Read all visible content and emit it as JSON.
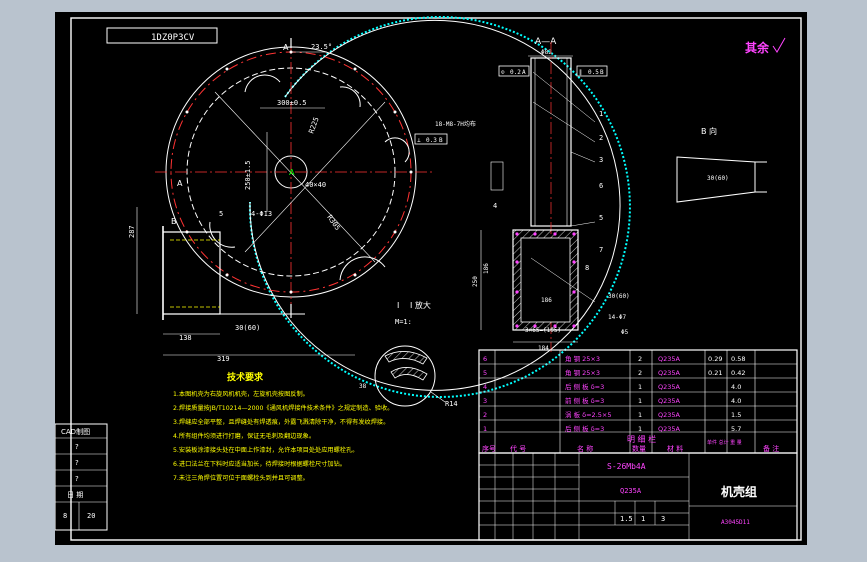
{
  "title_block": {
    "drawing_id": "1DZ0P3CV",
    "roughness_note": "其余",
    "spec": "S-26Mb4A",
    "material": "Q235A",
    "part_name": "机壳组",
    "drawing_no": "A3045D11",
    "scale_row": [
      "1.5",
      "1",
      "3"
    ]
  },
  "cad_panel": {
    "header": "CAD制图",
    "rows": [
      "?",
      "?",
      "?",
      "日 期"
    ],
    "bottom_a": "8",
    "bottom_b": "20"
  },
  "views": {
    "section_aa": "A—A",
    "view_b": "B 向",
    "detail_i": "I 放大",
    "detail_scale": "M=1:",
    "label_a": "A",
    "label_b": "B",
    "label_a2": "A",
    "roman_i": "I"
  },
  "dimensions": {
    "angle": "23.5°",
    "d300": "300±0.5",
    "r_ring": "R225",
    "h250": "250±1.5",
    "d40": "40×40",
    "hole": "4-Φ13",
    "r305": "R305",
    "w138": "138",
    "w319": "319",
    "h287": "287",
    "phi82": "Φ82",
    "d30": "30(60)",
    "weld1": "18-M8-7H均布",
    "w184": "184",
    "w186": "186",
    "cc": "3×65=(195)",
    "h250b": "250",
    "h186": "186",
    "m14": "14-Φ7",
    "phi5": "Φ5",
    "r14": "R14",
    "d38": "38",
    "d30b": "30(60)",
    "d30c": "30(60)"
  },
  "fcf": [
    {
      "sym": "⊙",
      "val": "0.2",
      "ref": "A"
    },
    {
      "sym": "∥",
      "val": "0.5",
      "ref": "B"
    },
    {
      "sym": "⊥",
      "val": "0.3",
      "ref": "B"
    }
  ],
  "balloons": [
    "1",
    "2",
    "3",
    "4",
    "5",
    "6",
    "7",
    "8"
  ],
  "tech_notes": {
    "title": "技术要求",
    "lines": [
      "1.本图机壳为右旋风机机壳，左旋机壳按图反制。",
      "2.焊接质量按JB/T10214—2000《通风机焊接件技术条件》之规定制造、验收。",
      "3.焊缝应全部平整，且焊缝处有焊透痕，外露飞溅清除干净，不得有发纹焊接。",
      "4.所有组件均须进行打磨，保证无毛刺及翻边现象。",
      "5.安装板涂漆接头处在中面上作漆封，允许本项目处处应用螺栓孔。",
      "6.进口法兰在下料时应适当加长，待焊接时根据螺栓尺寸加钻。",
      "7.未注三角焊位置可位于面螺栓头到并且可调整。"
    ]
  },
  "bom": {
    "rows": [
      {
        "no": "6",
        "name": "角  钢 25×3",
        "qty": "2",
        "mat": "Q235A",
        "w1": "0.29",
        "w2": "0.58"
      },
      {
        "no": "5",
        "name": "角  钢 25×3",
        "qty": "2",
        "mat": "Q235A",
        "w1": "0.21",
        "w2": "0.42"
      },
      {
        "no": "4",
        "name": "后 侧 板 δ=3",
        "qty": "1",
        "mat": "Q235A",
        "w1": "",
        "w2": "4.0"
      },
      {
        "no": "3",
        "name": "前 侧 板 δ=3",
        "qty": "1",
        "mat": "Q235A",
        "w1": "",
        "w2": "4.0"
      },
      {
        "no": "2",
        "name": "涡 板 δ=2.5×5",
        "qty": "1",
        "mat": "Q235A",
        "w1": "",
        "w2": "1.5"
      },
      {
        "no": "1",
        "name": "后 侧 板 δ=3",
        "qty": "1",
        "mat": "Q235A",
        "w1": "",
        "w2": "5.7"
      }
    ],
    "header": [
      "序号",
      "代  号",
      "名  称",
      "数量",
      "材  料",
      "单件 总计 重  量",
      "备  注"
    ],
    "section_label": "明    细    栏"
  }
}
